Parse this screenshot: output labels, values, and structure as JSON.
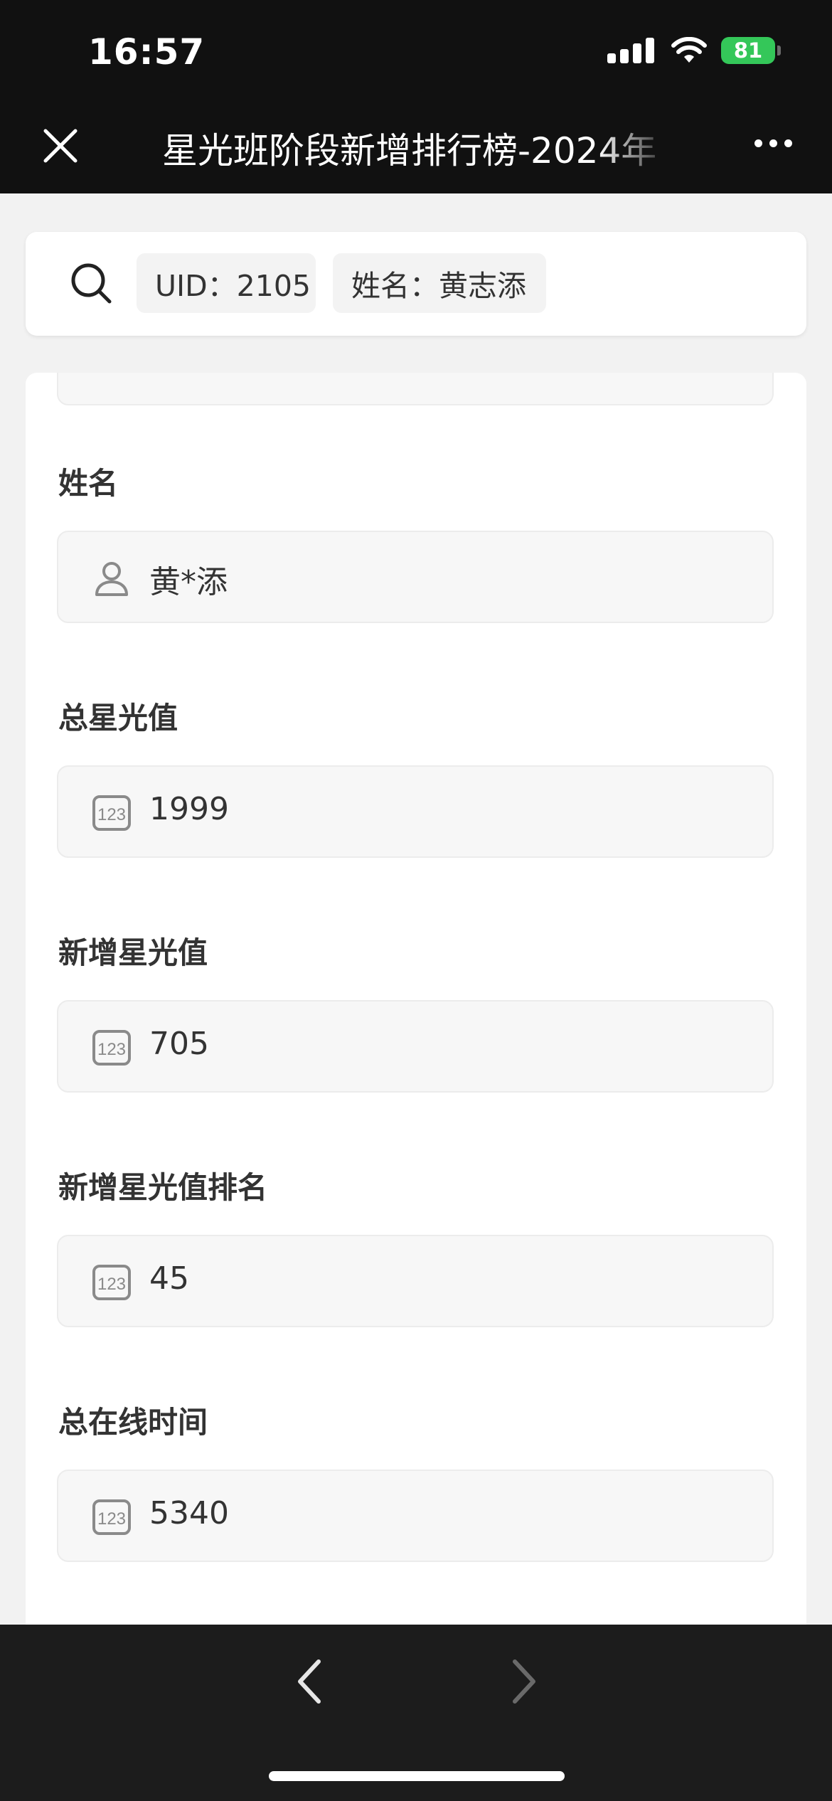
{
  "status_bar": {
    "time": "16:57",
    "battery": "81",
    "icons": [
      "signal-icon",
      "wifi-icon",
      "battery-icon"
    ]
  },
  "nav": {
    "title": "星光班阶段新增排行榜-2024年",
    "close_icon": "close-icon",
    "more_icon": "more-icon"
  },
  "search": {
    "icon": "search-icon",
    "chips": [
      {
        "text": "UID：2105"
      },
      {
        "text": "姓名：黄志添"
      }
    ]
  },
  "fields": [
    {
      "label": "姓名",
      "value": "黄*添",
      "icon": "person-icon"
    },
    {
      "label": "总星光值",
      "value": "1999",
      "icon": "number-icon"
    },
    {
      "label": "新增星光值",
      "value": "705",
      "icon": "number-icon"
    },
    {
      "label": "新增星光值排名",
      "value": "45",
      "icon": "number-icon"
    },
    {
      "label": "总在线时间",
      "value": "5340",
      "icon": "number-icon"
    }
  ],
  "toolbar": {
    "back_icon": "chevron-left-icon",
    "forward_icon": "chevron-right-icon"
  },
  "colors": {
    "top_bar": "#111111",
    "bottom_bar": "#1c1c1c",
    "page_background": "#f2f2f2",
    "battery": "#34c759"
  }
}
